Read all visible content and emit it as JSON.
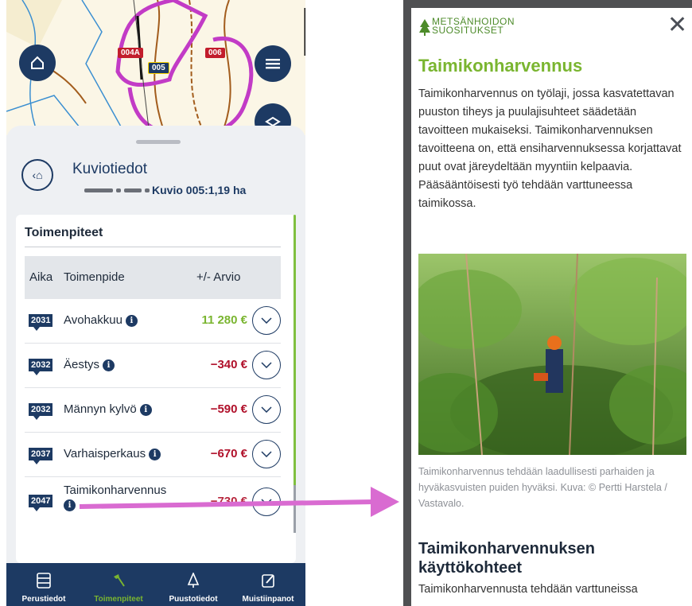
{
  "map": {
    "tags": [
      {
        "label": "004A",
        "color": "#c21d2c"
      },
      {
        "label": "005",
        "color": "#1d3a63"
      },
      {
        "label": "006",
        "color": "#c21d2c"
      }
    ]
  },
  "kuvio": {
    "title": "Kuviotiedot",
    "subtitle": "Kuvio 005:1,19 ha"
  },
  "toimenpiteet": {
    "title": "Toimenpiteet",
    "columns": [
      "Aika",
      "Toimenpide",
      "+/- Arvio"
    ],
    "rows": [
      {
        "year": "2031",
        "name": "Avohakkuu",
        "value": "11 280 €",
        "value_color": "#7ab530"
      },
      {
        "year": "2032",
        "name": "Äestys",
        "value": "−340 €",
        "value_color": "#b0102a"
      },
      {
        "year": "2032",
        "name": "Männyn kylvö",
        "value": "−590 €",
        "value_color": "#b0102a"
      },
      {
        "year": "2037",
        "name": "Varhaisperkaus",
        "value": "−670 €",
        "value_color": "#b0102a"
      },
      {
        "year": "2047",
        "name": "Taimikonharvennus",
        "value": "−730 €",
        "value_color": "#b0102a"
      }
    ]
  },
  "nav": {
    "items": [
      {
        "label": "Perustiedot",
        "icon": "table-icon",
        "active": false
      },
      {
        "label": "Toimenpiteet",
        "icon": "axe-icon",
        "active": true
      },
      {
        "label": "Puustotiedot",
        "icon": "tree-icon",
        "active": false
      },
      {
        "label": "Muistiinpanot",
        "icon": "edit-icon",
        "active": false
      }
    ],
    "active_color": "#7ab530"
  },
  "article": {
    "logo_line1": "METSÄNHOIDON",
    "logo_line2": "SUOSITUKSET",
    "title": "Taimikonharvennus",
    "body": "Taimikonharvennus on työlaji, jossa kasvatettavan puuston tiheys ja puulajisuhteet säädetään tavoitteen mukaiseksi. Taimikonharvennuksen tavoitteena on, että ensiharvennuksessa korjattavat puut ovat järeydeltään myyntiin kelpaavia. Pääsääntöisesti työ tehdään varttuneessa taimikossa.",
    "caption": "Taimikonharvennus tehdään laadullisesti parhaiden ja hyväkasvuisten puiden hyväksi. Kuva: © Pertti Harstela / Vastavalo.",
    "subheading": "Taimikonharvennuksen käyttökohteet",
    "body2": "Taimikonharvennusta tehdään varttuneissa"
  },
  "colors": {
    "navy": "#1d3a63",
    "green": "#7ab530",
    "negative": "#b0102a",
    "arrow": "#d96bd1"
  }
}
